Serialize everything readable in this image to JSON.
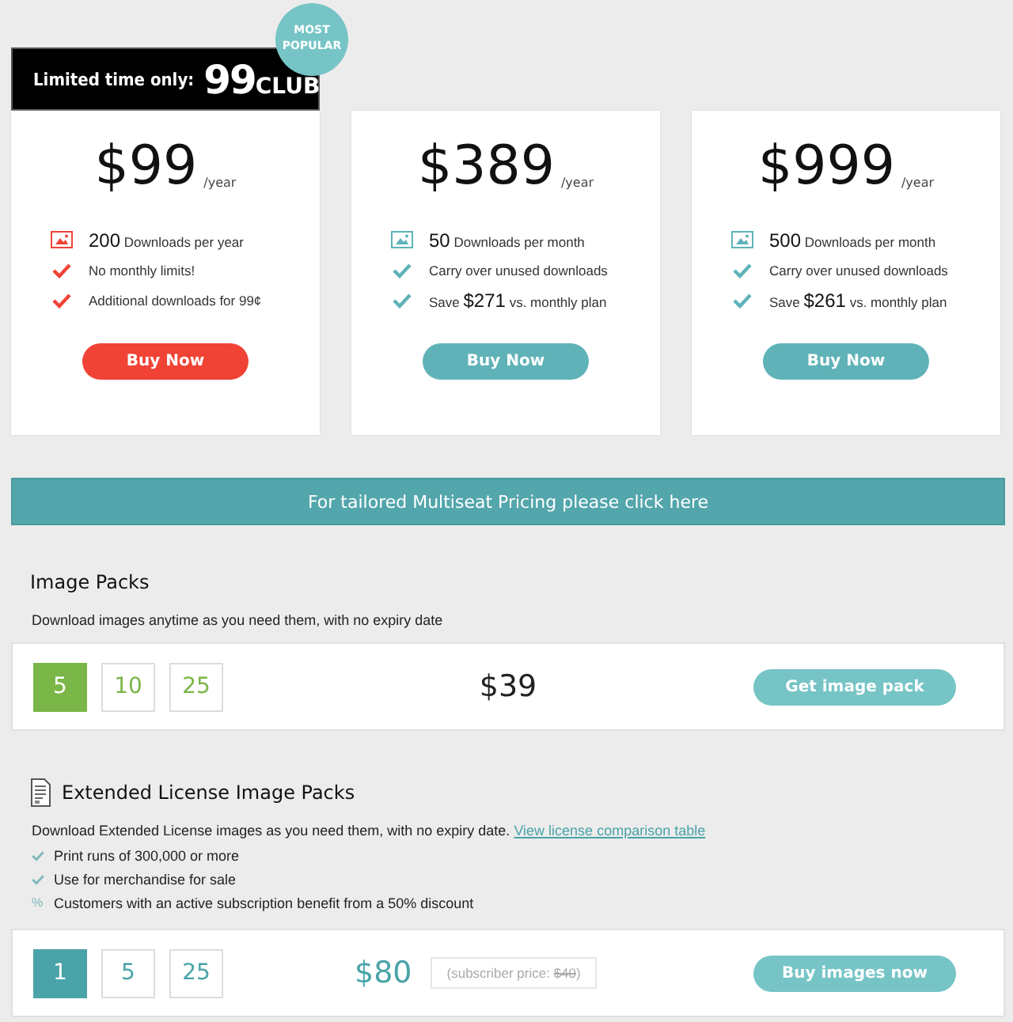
{
  "plans": [
    {
      "header": {
        "prefix": "Limited time only:",
        "number": "99",
        "suffix": "CLUB"
      },
      "badge": "MOST POPULAR",
      "color": "#f04336",
      "price": "$99",
      "period": "/year",
      "features": [
        {
          "kind": "image",
          "text": "**200** Downloads per year"
        },
        {
          "kind": "check",
          "text": "No monthly limits!"
        },
        {
          "kind": "check",
          "text": "Additional downloads for 99¢"
        }
      ],
      "button": "Buy Now"
    },
    {
      "color": "#5fb3b8",
      "price": "$389",
      "period": "/year",
      "features": [
        {
          "kind": "image",
          "text": "**50** Downloads per month"
        },
        {
          "kind": "check",
          "text": "Carry over unused downloads"
        },
        {
          "kind": "check",
          "text": "Save **$271** vs. monthly plan"
        }
      ],
      "button": "Buy Now"
    },
    {
      "color": "#5fb3b8",
      "price": "$999",
      "period": "/year",
      "features": [
        {
          "kind": "image",
          "text": "**500** Downloads per month"
        },
        {
          "kind": "check",
          "text": "Carry over unused downloads"
        },
        {
          "kind": "check",
          "text": "Save **$261** vs. monthly plan"
        }
      ],
      "button": "Buy Now"
    }
  ],
  "banner": "For tailored Multiseat Pricing please click here",
  "packs": [
    {
      "title": "Image Packs",
      "icon": false,
      "description": "Download images anytime as you need them, with no expiry date",
      "color": "#7ab648",
      "options": [
        {
          "label": "5",
          "selected": true
        },
        {
          "label": "10",
          "selected": false
        },
        {
          "label": "25",
          "selected": false
        }
      ],
      "price": "$39",
      "button": "Get image pack"
    },
    {
      "title": "Extended License Image Packs",
      "icon": true,
      "description": "Download Extended License images as you need them, with no expiry date.",
      "link": "View license comparison table",
      "features": [
        {
          "kind": "check",
          "text": "Print runs of 300,000 or more"
        },
        {
          "kind": "check",
          "text": "Use for merchandise for sale"
        },
        {
          "kind": "percent",
          "marker": "%",
          "text": "Customers with an active subscription benefit from a 50% discount"
        }
      ],
      "color": "#4aa3a8",
      "options": [
        {
          "label": "1",
          "selected": true
        },
        {
          "label": "5",
          "selected": false
        },
        {
          "label": "25",
          "selected": false
        }
      ],
      "price": "$80",
      "note": {
        "label": "(subscriber price: ",
        "struck": "$40",
        "suffix": ")"
      },
      "button": "Buy images now"
    }
  ]
}
